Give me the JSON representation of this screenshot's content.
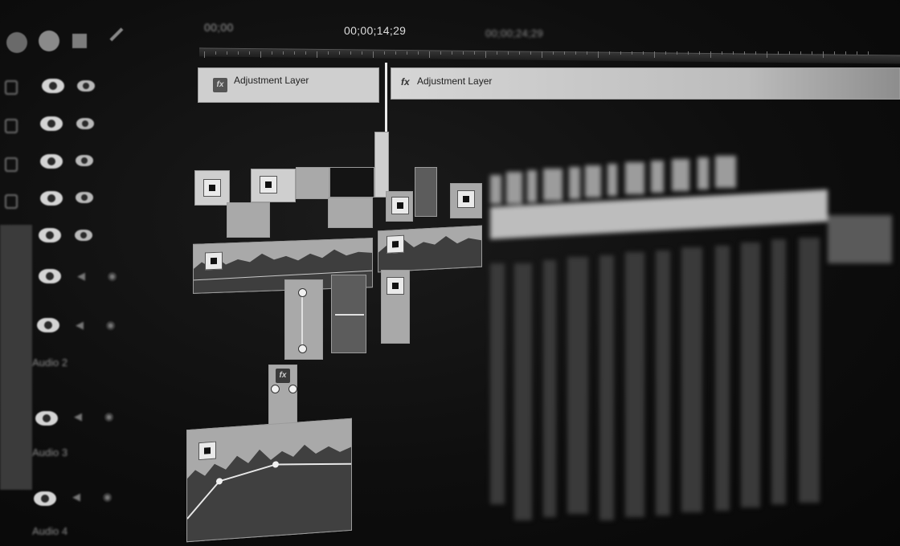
{
  "ruler": {
    "left_timecode": "00;00",
    "playhead_timecode": "00;00;14;29",
    "right_timecode": "00;00;24;29"
  },
  "clips": {
    "adjustment_layer_1": "Adjustment Layer",
    "adjustment_layer_2": "Adjustment Layer",
    "fx_symbol": "fx"
  },
  "tracks": {
    "audio_labels": [
      "Audio 2",
      "Audio 3",
      "Audio 4"
    ]
  },
  "icons": {
    "eye": "eye-icon",
    "lock": "lock-icon",
    "speaker": "speaker-icon",
    "fx": "fx-icon"
  },
  "colors": {
    "background": "#0c0c0c",
    "clip_light": "#cfcfcf",
    "clip_mid": "#a9a9a9",
    "playhead": "#ececec"
  }
}
